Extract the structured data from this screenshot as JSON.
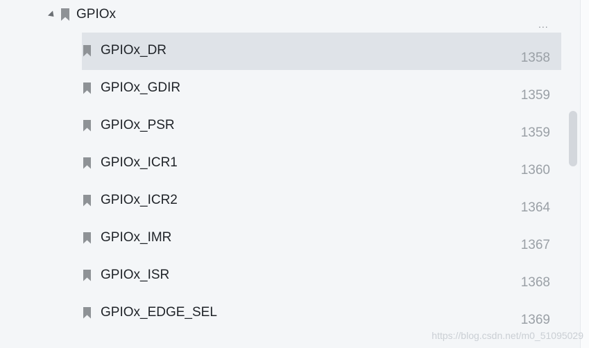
{
  "tree": {
    "parent": {
      "label": "GPIOx",
      "expanded_icon": "triangle-down-icon",
      "bookmark_icon": "bookmark-icon",
      "more_label": "..."
    },
    "items": [
      {
        "label": "GPIOx_DR",
        "page": "1358",
        "selected": true
      },
      {
        "label": "GPIOx_GDIR",
        "page": "1359",
        "selected": false
      },
      {
        "label": "GPIOx_PSR",
        "page": "1359",
        "selected": false
      },
      {
        "label": "GPIOx_ICR1",
        "page": "1360",
        "selected": false
      },
      {
        "label": "GPIOx_ICR2",
        "page": "1364",
        "selected": false
      },
      {
        "label": "GPIOx_IMR",
        "page": "1367",
        "selected": false
      },
      {
        "label": "GPIOx_ISR",
        "page": "1368",
        "selected": false
      },
      {
        "label": "GPIOx_EDGE_SEL",
        "page": "1369",
        "selected": false
      }
    ]
  },
  "watermark": "https://blog.csdn.net/m0_51095029",
  "colors": {
    "background": "#f4f6f8",
    "selected_row": "#dfe3e8",
    "text": "#1f2328",
    "page_number": "#9aa0a6",
    "icon": "#8e9296"
  }
}
